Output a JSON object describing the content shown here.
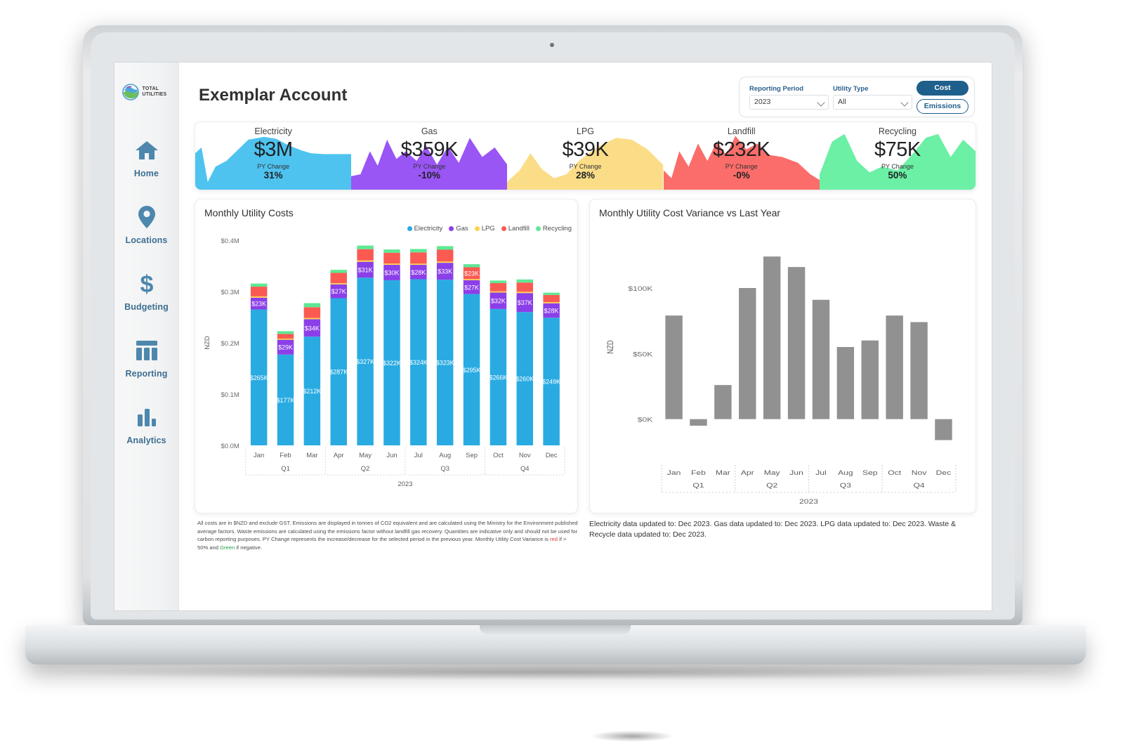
{
  "app": {
    "brand_line1": "TOTAL",
    "brand_line2": "UTILITIES",
    "brand_logo_icon": "globe-leaf-logo-icon",
    "page_title": "Exemplar Account"
  },
  "sidebar": {
    "items": [
      {
        "label": "Home",
        "icon": "home-icon"
      },
      {
        "label": "Locations",
        "icon": "map-pin-icon"
      },
      {
        "label": "Budgeting",
        "icon": "dollar-sign-icon"
      },
      {
        "label": "Reporting",
        "icon": "table-columns-icon"
      },
      {
        "label": "Analytics",
        "icon": "bar-chart-icon"
      }
    ]
  },
  "filters": {
    "reporting_period": {
      "label": "Reporting Period",
      "value": "2023"
    },
    "utility_type": {
      "label": "Utility Type",
      "value": "All"
    },
    "mode_cost": "Cost",
    "mode_emissions": "Emissions",
    "active_mode": "Cost"
  },
  "kpis": [
    {
      "title": "Electricity",
      "value": "$3M",
      "py_label": "PY Change",
      "py_change": "31%",
      "color": "#42b6e8"
    },
    {
      "title": "Gas",
      "value": "$359K",
      "py_label": "PY Change",
      "py_change": "-10%",
      "color": "#9a55f5"
    },
    {
      "title": "LPG",
      "value": "$39K",
      "py_label": "PY Change",
      "py_change": "28%",
      "color": "#fbdd88"
    },
    {
      "title": "Landfill",
      "value": "$232K",
      "py_label": "PY Change",
      "py_change": "-0%",
      "color": "#fb6d6a"
    },
    {
      "title": "Recycling",
      "value": "$75K",
      "py_label": "PY Change",
      "py_change": "50%",
      "color": "#6bf0a5"
    }
  ],
  "left_panel": {
    "title": "Monthly Utility Costs"
  },
  "right_panel": {
    "title": "Monthly Utility Cost Variance vs Last Year"
  },
  "footnotes": {
    "left_part1": "All costs are in $NZD and exclude GST.  Emissions are displayed in tonnes of CO2 equivalent and are calculated using the Ministry for the Environment published average factors.  Waste emissions are calculated using the emissions factor without landfill gas recovery.  Quantities are indicative only and should not be used for carbon reporting purposes. PY Change represents the increase/decrease for the selected period in the previous year.  Monthly Utility Cost Variance is ",
    "left_red": "red",
    "left_part2": " if > 50% and ",
    "left_green": "Green",
    "left_part3": " if negative.",
    "right": "Electricity data updated to: Dec 2023. Gas data updated to: Dec 2023. LPG data updated to: Dec 2023. Waste & Recycle data updated to: Dec 2023."
  },
  "chart_data": [
    {
      "type": "bar",
      "stacked": true,
      "title": "Monthly Utility Costs",
      "xlabel": "2023",
      "ylabel": "NZD",
      "ylim": [
        0,
        400000
      ],
      "ytick_labels": [
        "$0.0M",
        "$0.1M",
        "$0.2M",
        "$0.3M",
        "$0.4M"
      ],
      "ytick_values": [
        0,
        100000,
        200000,
        300000,
        400000
      ],
      "categories": [
        "Jan",
        "Feb",
        "Mar",
        "Apr",
        "May",
        "Jun",
        "Jul",
        "Aug",
        "Sep",
        "Oct",
        "Nov",
        "Dec"
      ],
      "quarter_groups": [
        {
          "label": "Q1",
          "months": [
            "Jan",
            "Feb",
            "Mar"
          ]
        },
        {
          "label": "Q2",
          "months": [
            "Apr",
            "May",
            "Jun"
          ]
        },
        {
          "label": "Q3",
          "months": [
            "Jul",
            "Aug",
            "Sep"
          ]
        },
        {
          "label": "Q4",
          "months": [
            "Oct",
            "Nov",
            "Dec"
          ]
        }
      ],
      "legend": [
        "Electricity",
        "Gas",
        "LPG",
        "Landfill",
        "Recycling"
      ],
      "legend_position": "top-right",
      "colors": {
        "Electricity": "#29ABE2",
        "Gas": "#8B3FE8",
        "LPG": "#FFD24D",
        "Landfill": "#FB5A52",
        "Recycling": "#5EE894"
      },
      "series": [
        {
          "name": "Electricity",
          "values": [
            265000,
            177000,
            212000,
            287000,
            327000,
            322000,
            324000,
            323000,
            295000,
            266000,
            260000,
            249000
          ],
          "labels": [
            "$265K",
            "$177K",
            "$212K",
            "$287K",
            "$327K",
            "$322K",
            "$324K",
            "$323K",
            "$295K",
            "$266K",
            "$260K",
            "$249K"
          ]
        },
        {
          "name": "Gas",
          "values": [
            23000,
            29000,
            34000,
            27000,
            31000,
            30000,
            28000,
            33000,
            27000,
            32000,
            37000,
            28000
          ],
          "labels": [
            "$23K",
            "$29K",
            "$34K",
            "$27K",
            "$31K",
            "$30K",
            "$28K",
            "$33K",
            "$27K",
            "$32K",
            "$37K",
            "$28K"
          ]
        },
        {
          "name": "LPG",
          "values": [
            2500,
            2200,
            2400,
            2300,
            2600,
            2500,
            2400,
            2500,
            2300,
            2400,
            2500,
            2300
          ],
          "labels": []
        },
        {
          "name": "Landfill",
          "values": [
            19000,
            9000,
            21000,
            20000,
            22000,
            21000,
            22000,
            23000,
            23000,
            16000,
            18000,
            14000
          ],
          "labels": [
            "",
            "",
            "",
            "",
            "",
            "",
            "",
            "",
            "$23K",
            "",
            "",
            " "
          ]
        },
        {
          "name": "Recycling",
          "values": [
            6000,
            5500,
            8000,
            6000,
            7000,
            6500,
            6500,
            7000,
            6000,
            5000,
            6000,
            4500
          ],
          "labels": []
        }
      ]
    },
    {
      "type": "bar",
      "stacked": false,
      "title": "Monthly Utility Cost Variance vs Last Year",
      "xlabel": "2023",
      "ylabel": "NZD",
      "ylim": [
        -20000,
        130000
      ],
      "ytick_labels": [
        "$0K",
        "$50K",
        "$100K"
      ],
      "ytick_values": [
        0,
        50000,
        100000
      ],
      "categories": [
        "Jan",
        "Feb",
        "Mar",
        "Apr",
        "May",
        "Jun",
        "Jul",
        "Aug",
        "Sep",
        "Oct",
        "Nov",
        "Dec"
      ],
      "quarter_groups": [
        {
          "label": "Q1",
          "months": [
            "Jan",
            "Feb",
            "Mar"
          ]
        },
        {
          "label": "Q2",
          "months": [
            "Apr",
            "May",
            "Jun"
          ]
        },
        {
          "label": "Q3",
          "months": [
            "Jul",
            "Aug",
            "Sep"
          ]
        },
        {
          "label": "Q4",
          "months": [
            "Oct",
            "Nov",
            "Dec"
          ]
        }
      ],
      "bar_color": "#919191",
      "series": [
        {
          "name": "Variance",
          "values": [
            79000,
            -5000,
            26000,
            100000,
            124000,
            116000,
            91000,
            55000,
            60000,
            79000,
            74000,
            -16000
          ]
        }
      ]
    }
  ]
}
